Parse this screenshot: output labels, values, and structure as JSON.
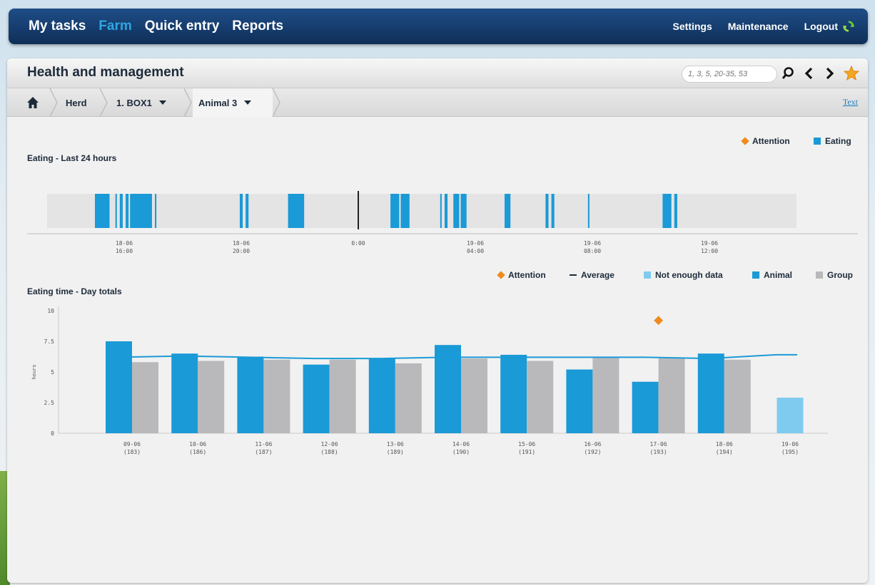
{
  "nav": {
    "main": [
      "My tasks",
      "Farm",
      "Quick entry",
      "Reports"
    ],
    "active": "Farm",
    "settings": "Settings",
    "maintenance": "Maintenance",
    "logout": "Logout"
  },
  "page": {
    "title": "Health and management",
    "search_placeholder": "1, 3, 5, 20-35, 53"
  },
  "breadcrumb": {
    "herd": "Herd",
    "box": "1. BOX1",
    "animal": "Animal 3",
    "text_link": "Text"
  },
  "colors": {
    "animal": "#1a9ad6",
    "group": "#b9b9bc",
    "not_enough_data": "#7fcbef",
    "attention": "#ef8a1c",
    "average": "#1a9ad6",
    "nav_active": "#2ea6e0"
  },
  "icons": {
    "home": "home-icon",
    "search": "search-icon",
    "prev": "chevron-left-icon",
    "next": "chevron-right-icon",
    "favorite": "star-icon",
    "logout": "refresh-icon"
  },
  "chart_data": [
    {
      "type": "timeline",
      "title": "Eating - Last 24 hours",
      "legend": [
        "Attention",
        "Eating"
      ],
      "x_ticks": [
        {
          "time": "16:00",
          "label": [
            "18-06",
            "16:00"
          ]
        },
        {
          "time": "20:00",
          "label": [
            "18-06",
            "20:00"
          ]
        },
        {
          "time": "0:00",
          "label": [
            "0:00"
          ]
        },
        {
          "time": "04:00",
          "label": [
            "19-06",
            "04:00"
          ]
        },
        {
          "time": "08:00",
          "label": [
            "19-06",
            "08:00"
          ]
        },
        {
          "time": "12:00",
          "label": [
            "19-06",
            "12:00"
          ]
        }
      ],
      "series": [
        {
          "name": "Eating",
          "intervals_h": [
            [
              -9.0,
              -8.5
            ],
            [
              -8.3,
              -8.25
            ],
            [
              -8.15,
              -8.05
            ],
            [
              -7.95,
              -7.85
            ],
            [
              -7.8,
              -7.05
            ],
            [
              -6.95,
              -6.9
            ],
            [
              -4.05,
              -3.95
            ],
            [
              -3.85,
              -3.75
            ],
            [
              -2.4,
              -1.85
            ],
            [
              1.1,
              1.4
            ],
            [
              1.45,
              1.75
            ],
            [
              2.8,
              2.85
            ],
            [
              2.95,
              3.05
            ],
            [
              3.25,
              3.45
            ],
            [
              3.5,
              3.7
            ],
            [
              5.0,
              5.2
            ],
            [
              6.4,
              6.5
            ],
            [
              6.6,
              6.7
            ],
            [
              7.85,
              7.9
            ],
            [
              10.4,
              10.7
            ],
            [
              10.8,
              10.9
            ]
          ]
        }
      ]
    },
    {
      "type": "bar",
      "title": "Eating time - Day totals",
      "ylabel": "hours",
      "ylim": [
        0,
        10
      ],
      "yticks": [
        "0",
        "2.5",
        "5",
        "7.5",
        "10"
      ],
      "categories": [
        [
          "09-06",
          "(183)"
        ],
        [
          "10-06",
          "(186)"
        ],
        [
          "11-06",
          "(187)"
        ],
        [
          "12-06",
          "(188)"
        ],
        [
          "13-06",
          "(189)"
        ],
        [
          "14-06",
          "(190)"
        ],
        [
          "15-06",
          "(191)"
        ],
        [
          "16-06",
          "(192)"
        ],
        [
          "17-06",
          "(193)"
        ],
        [
          "18-06",
          "(194)"
        ],
        [
          "19-06",
          "(195)"
        ]
      ],
      "legend": [
        "Attention",
        "Average",
        "Not enough data",
        "Animal",
        "Group"
      ],
      "series": [
        {
          "name": "Animal",
          "values": [
            7.5,
            6.5,
            6.25,
            5.6,
            6.1,
            7.2,
            6.4,
            5.2,
            4.2,
            6.5,
            null
          ]
        },
        {
          "name": "Group",
          "values": [
            5.8,
            5.9,
            6.0,
            6.0,
            5.7,
            6.1,
            5.9,
            6.2,
            6.1,
            6.0,
            null
          ]
        },
        {
          "name": "Not enough data",
          "values": [
            null,
            null,
            null,
            null,
            null,
            null,
            null,
            null,
            null,
            null,
            2.9
          ]
        },
        {
          "name": "Average",
          "values": [
            6.2,
            6.3,
            6.2,
            6.1,
            6.1,
            6.2,
            6.2,
            6.2,
            6.2,
            6.1,
            6.4
          ]
        }
      ],
      "attention": [
        {
          "category": "17-06",
          "value": 9.2
        }
      ]
    }
  ]
}
